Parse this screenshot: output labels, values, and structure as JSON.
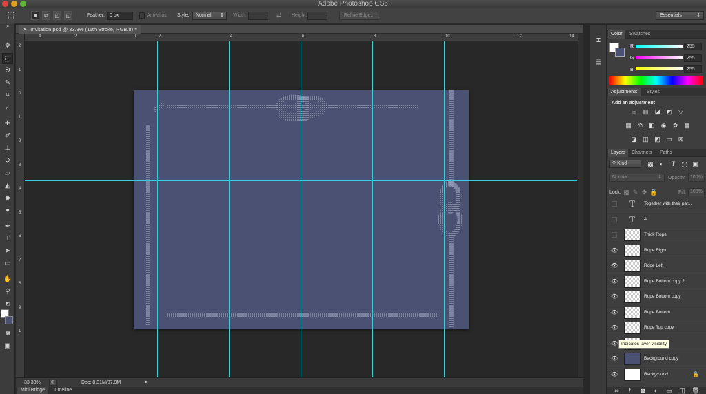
{
  "app": {
    "title": "Adobe Photoshop CS6"
  },
  "colors": {
    "guide": "#34d1dd",
    "document_fill": "#4a5172",
    "rope": "#c6c9d8"
  },
  "options_bar": {
    "feather_label": "Feather:",
    "feather_value": "0 px",
    "anti_alias_label": "Anti-alias",
    "style_label": "Style:",
    "style_value": "Normal",
    "width_label": "Width:",
    "height_label": "Height:",
    "refine_edge_label": "Refine Edge...",
    "workspace_value": "Essentials"
  },
  "document": {
    "tab_title": "Invitation.psd @ 33.3% (11th Stroke, RGB/8) *"
  },
  "rulers": {
    "horizontal": [
      "4",
      "2",
      "0",
      "2",
      "4",
      "6",
      "8",
      "10",
      "12",
      "14"
    ],
    "vertical": [
      "2",
      "1",
      "0",
      "1",
      "2",
      "3",
      "4",
      "5",
      "6",
      "7",
      "8",
      "9",
      "1"
    ]
  },
  "status": {
    "zoom": "33.33%",
    "doc_size": "Doc: 8.31M/37.9M"
  },
  "bottom_tabs": [
    "Mini Bridge",
    "Timeline"
  ],
  "color_panel": {
    "tabs": [
      "Color",
      "Swatches"
    ],
    "channels": [
      {
        "label": "R",
        "value": "255"
      },
      {
        "label": "G",
        "value": "255"
      },
      {
        "label": "B",
        "value": "255"
      }
    ]
  },
  "adjustments_panel": {
    "tabs": [
      "Adjustments",
      "Styles"
    ],
    "heading": "Add an adjustment"
  },
  "layers_panel": {
    "tabs": [
      "Layers",
      "Channels",
      "Paths"
    ],
    "filter_kind": "Kind",
    "blend_mode": "Normal",
    "opacity_label": "Opacity:",
    "opacity_value": "100%",
    "lock_label": "Lock:",
    "fill_label": "Fill:",
    "fill_value": "100%",
    "layers": [
      {
        "name": "Together with their par...",
        "thumb": "type",
        "visible": false
      },
      {
        "name": "&",
        "thumb": "type",
        "visible": false
      },
      {
        "name": "Thick Rope",
        "thumb": "checker",
        "visible": false
      },
      {
        "name": "Rope Right",
        "thumb": "checker",
        "visible": true
      },
      {
        "name": "Rope Left",
        "thumb": "checker",
        "visible": true
      },
      {
        "name": "Rope Bottom copy 2",
        "thumb": "checker",
        "visible": true
      },
      {
        "name": "Rope Bottom copy",
        "thumb": "checker",
        "visible": true
      },
      {
        "name": "Rope Bottom",
        "thumb": "checker",
        "visible": true
      },
      {
        "name": "Rope Top copy",
        "thumb": "checker",
        "visible": true
      },
      {
        "name": "Rope Top",
        "thumb": "checker",
        "visible": true
      },
      {
        "name": "Background copy",
        "thumb": "navy",
        "visible": true
      },
      {
        "name": "Background",
        "thumb": "white",
        "visible": true
      }
    ],
    "tooltip": "Indicates layer visibility"
  }
}
